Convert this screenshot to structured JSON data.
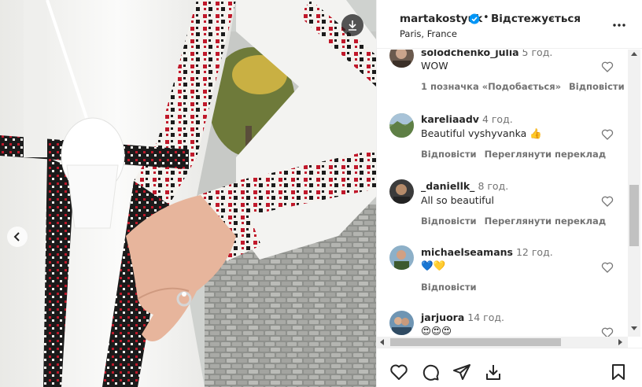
{
  "post": {
    "username": "martakostyuk",
    "separator": "•",
    "follow_label": "Відстежується",
    "location": "Paris, France"
  },
  "comments": [
    {
      "user": "solodchenko_julia",
      "time": "5 год.",
      "text": "WOW",
      "likes": "1 позначка «Подобається»",
      "reply": "Відповісти",
      "translate": ""
    },
    {
      "user": "kareliaadv",
      "time": "4 год.",
      "text": "Beautiful vyshyvanka 👍",
      "likes": "",
      "reply": "Відповісти",
      "translate": "Переглянути переклад"
    },
    {
      "user": "_daniellk_",
      "time": "8 год.",
      "text": "All so beautiful",
      "likes": "",
      "reply": "Відповісти",
      "translate": "Переглянути переклад"
    },
    {
      "user": "michaelseamans",
      "time": "12 год.",
      "text": "💙💛",
      "likes": "",
      "reply": "Відповісти",
      "translate": ""
    },
    {
      "user": "jarjuora",
      "time": "14 год.",
      "text": "😍😍😍",
      "likes": "",
      "reply": "",
      "translate": ""
    }
  ],
  "icons": {
    "verified": "verified-badge-icon",
    "more": "more-options-icon",
    "heart": "heart-icon",
    "comment": "comment-icon",
    "share": "share-icon",
    "save": "bookmark-icon",
    "download": "download-icon",
    "prev": "chevron-left-icon"
  },
  "colors": {
    "verified_blue": "#0095f6",
    "text": "#262626",
    "secondary": "#737373",
    "embroidery_red": "#c0182a",
    "embroidery_black": "#1b1b1b"
  }
}
